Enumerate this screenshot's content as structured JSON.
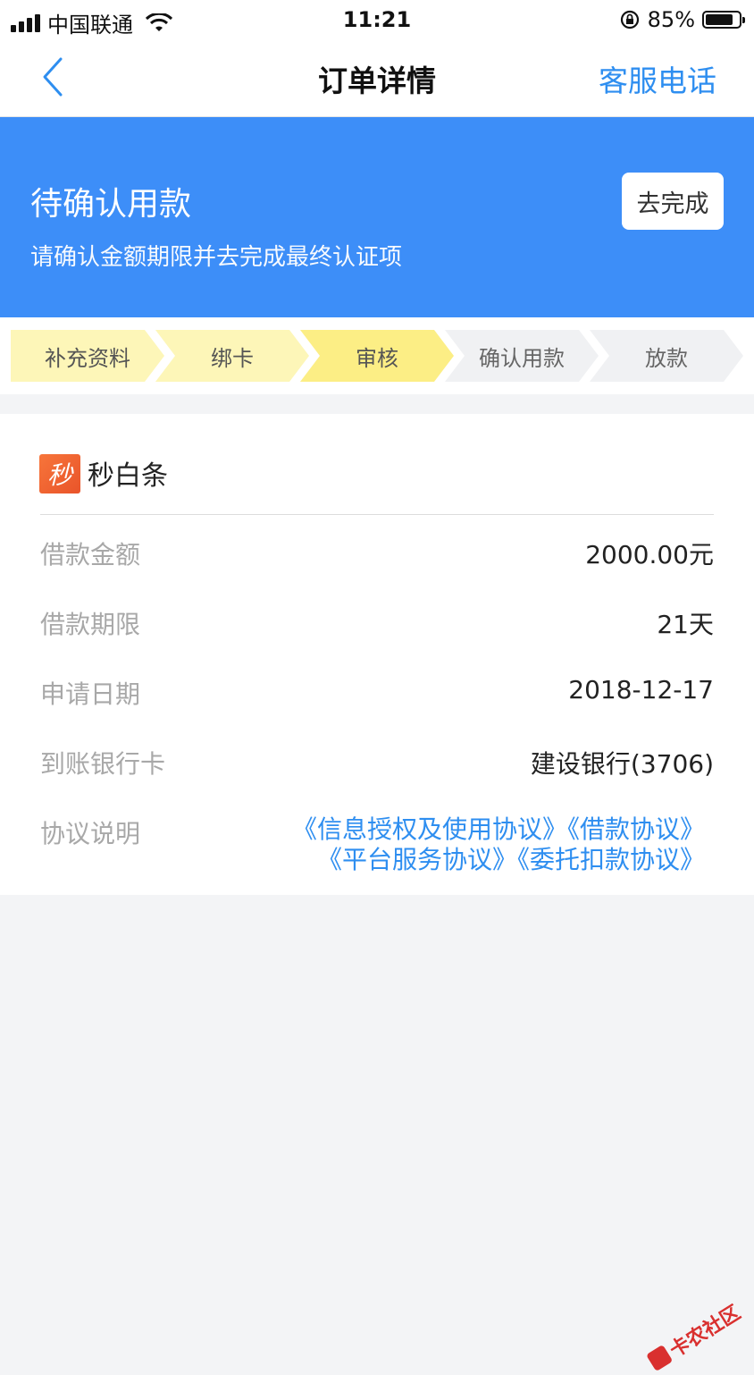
{
  "status_bar": {
    "carrier": "中国联通",
    "time": "11:21",
    "battery": "85%"
  },
  "nav": {
    "title": "订单详情",
    "right_action": "客服电话"
  },
  "banner": {
    "title": "待确认用款",
    "subtitle": "请确认金额期限并去完成最终认证项",
    "button_label": "去完成"
  },
  "steps": [
    {
      "label": "补充资料",
      "state": "done"
    },
    {
      "label": "绑卡",
      "state": "done"
    },
    {
      "label": "审核",
      "state": "active"
    },
    {
      "label": "确认用款",
      "state": "todo"
    },
    {
      "label": "放款",
      "state": "todo"
    }
  ],
  "product": {
    "icon_char": "秒",
    "name": "秒白条"
  },
  "details": [
    {
      "label": "借款金额",
      "value": "2000.00元"
    },
    {
      "label": "借款期限",
      "value": "21天"
    },
    {
      "label": "申请日期",
      "value": "2018-12-17"
    },
    {
      "label": "到账银行卡",
      "value": "建设银行(3706)"
    }
  ],
  "agreements": {
    "label": "协议说明",
    "items": [
      "《信息授权及使用协议》",
      "《借款协议》",
      "《平台服务协议》",
      "《委托扣款协议》"
    ]
  },
  "watermark": {
    "text": "卡农社区"
  },
  "colors": {
    "accent": "#3d8ef8",
    "link": "#2e8ef0",
    "step_done": "#fdf6b8",
    "step_active": "#fcee85",
    "step_todo": "#f0f1f3"
  }
}
